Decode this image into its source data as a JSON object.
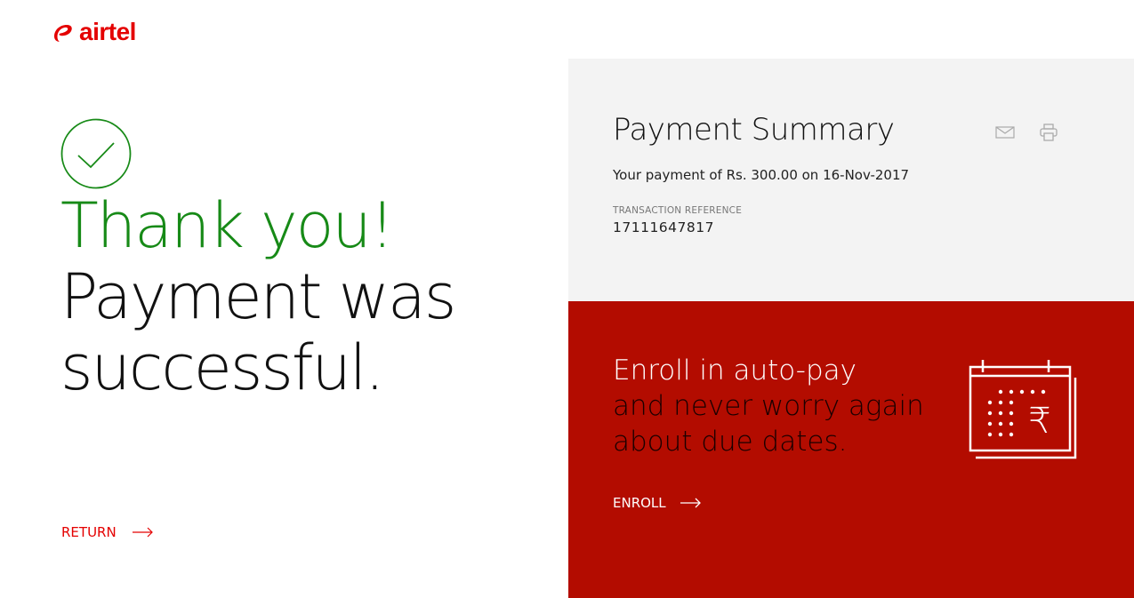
{
  "brand": {
    "name": "airtel",
    "color": "#e40000"
  },
  "success": {
    "icon": "check-circle-icon",
    "heading_line1": "Thank you!",
    "heading_line2": "Payment was successful.",
    "green": "#178a17"
  },
  "return_link": {
    "label": "RETURN",
    "icon": "arrow-right-icon"
  },
  "summary": {
    "title": "Payment Summary",
    "mail_icon": "mail-icon",
    "print_icon": "print-icon",
    "payment_line": "Your payment of Rs. 300.00 on 16-Nov-2017",
    "reference_label": "TRANSACTION REFERENCE",
    "reference_value": "17111647817"
  },
  "autopay": {
    "line1": "Enroll in auto-pay",
    "line2": "and never worry again",
    "line3": "about due dates.",
    "enroll_label": "ENROLL",
    "icon": "calendar-rupee-icon",
    "background": "#b30c00"
  }
}
